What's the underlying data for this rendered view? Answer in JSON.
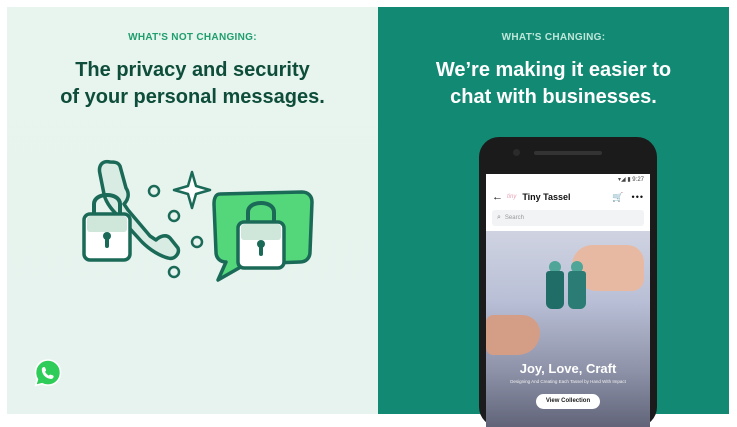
{
  "left_panel": {
    "eyebrow": "WHAT'S NOT CHANGING:",
    "headline_line1": "The privacy and security",
    "headline_line2": "of your personal messages."
  },
  "right_panel": {
    "eyebrow": "WHAT'S CHANGING:",
    "headline_line1": "We’re making it easier to",
    "headline_line2": "chat with businesses."
  },
  "phone": {
    "status_time": "▾◢ ▮ 9:27",
    "app_logo_text": "tiny",
    "shop_title": "Tiny Tassel",
    "search_placeholder": "Search",
    "hero_title": "Joy, Love, Craft",
    "hero_subtitle": "Designing And Creating Each Tassel by Hand With Impact",
    "cta_label": "View Collection"
  },
  "colors": {
    "left_bg": "#e6f3ee",
    "right_bg": "#128a73",
    "accent_green": "#1f9e6e",
    "dark_green": "#0e4d3a",
    "bubble_green": "#54d67a"
  },
  "icons": {
    "phone": "phone-handset-icon",
    "lock": "padlock-icon",
    "sparkle": "sparkle-icon",
    "bubble": "speech-bubble-icon",
    "whatsapp": "whatsapp-logo-icon",
    "back": "arrow-left-icon",
    "cart": "cart-icon",
    "more": "more-dots-icon",
    "search": "search-icon"
  }
}
